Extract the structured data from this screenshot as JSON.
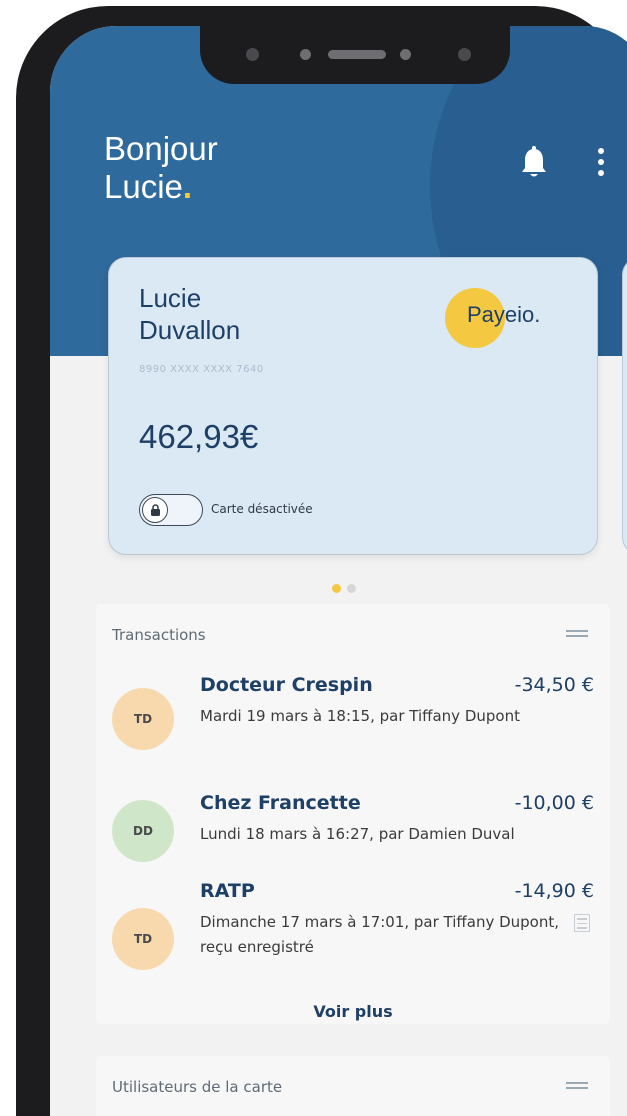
{
  "header": {
    "greeting_line1": "Bonjour",
    "greeting_line2": "Lucie",
    "greeting_dot": "."
  },
  "card": {
    "holder_first": "Lucie",
    "holder_last": "Duvallon",
    "number": "8990 XXXX XXXX 7640",
    "balance": "462,93€",
    "brand": "Payeio.",
    "status_label": "Carte désactivée",
    "toggle_on": false
  },
  "transactions": {
    "title": "Transactions",
    "items": [
      {
        "initials": "TD",
        "avatar_color": "#f7d9ad",
        "name": "Docteur Crespin",
        "amount": "-34,50 €",
        "description": "Mardi 19 mars à 18:15, par Tiffany Dupont",
        "has_receipt": false
      },
      {
        "initials": "DD",
        "avatar_color": "#cfe6c8",
        "name": "Chez Francette",
        "amount": "-10,00 €",
        "description": "Lundi 18 mars à 16:27, par Damien Duval",
        "has_receipt": false
      },
      {
        "initials": "TD",
        "avatar_color": "#f7d9ad",
        "name": "RATP",
        "amount": "-14,90 €",
        "description": "Dimanche 17 mars à 17:01, par Tiffany Dupont, reçu enregistré",
        "has_receipt": true
      }
    ],
    "more_label": "Voir plus"
  },
  "card_users": {
    "title": "Utilisateurs de la carte"
  },
  "colors": {
    "header": "#2f6a9c",
    "accent": "#f5c842",
    "text_primary": "#1e3f66",
    "card_bg": "#dbe9f4"
  }
}
